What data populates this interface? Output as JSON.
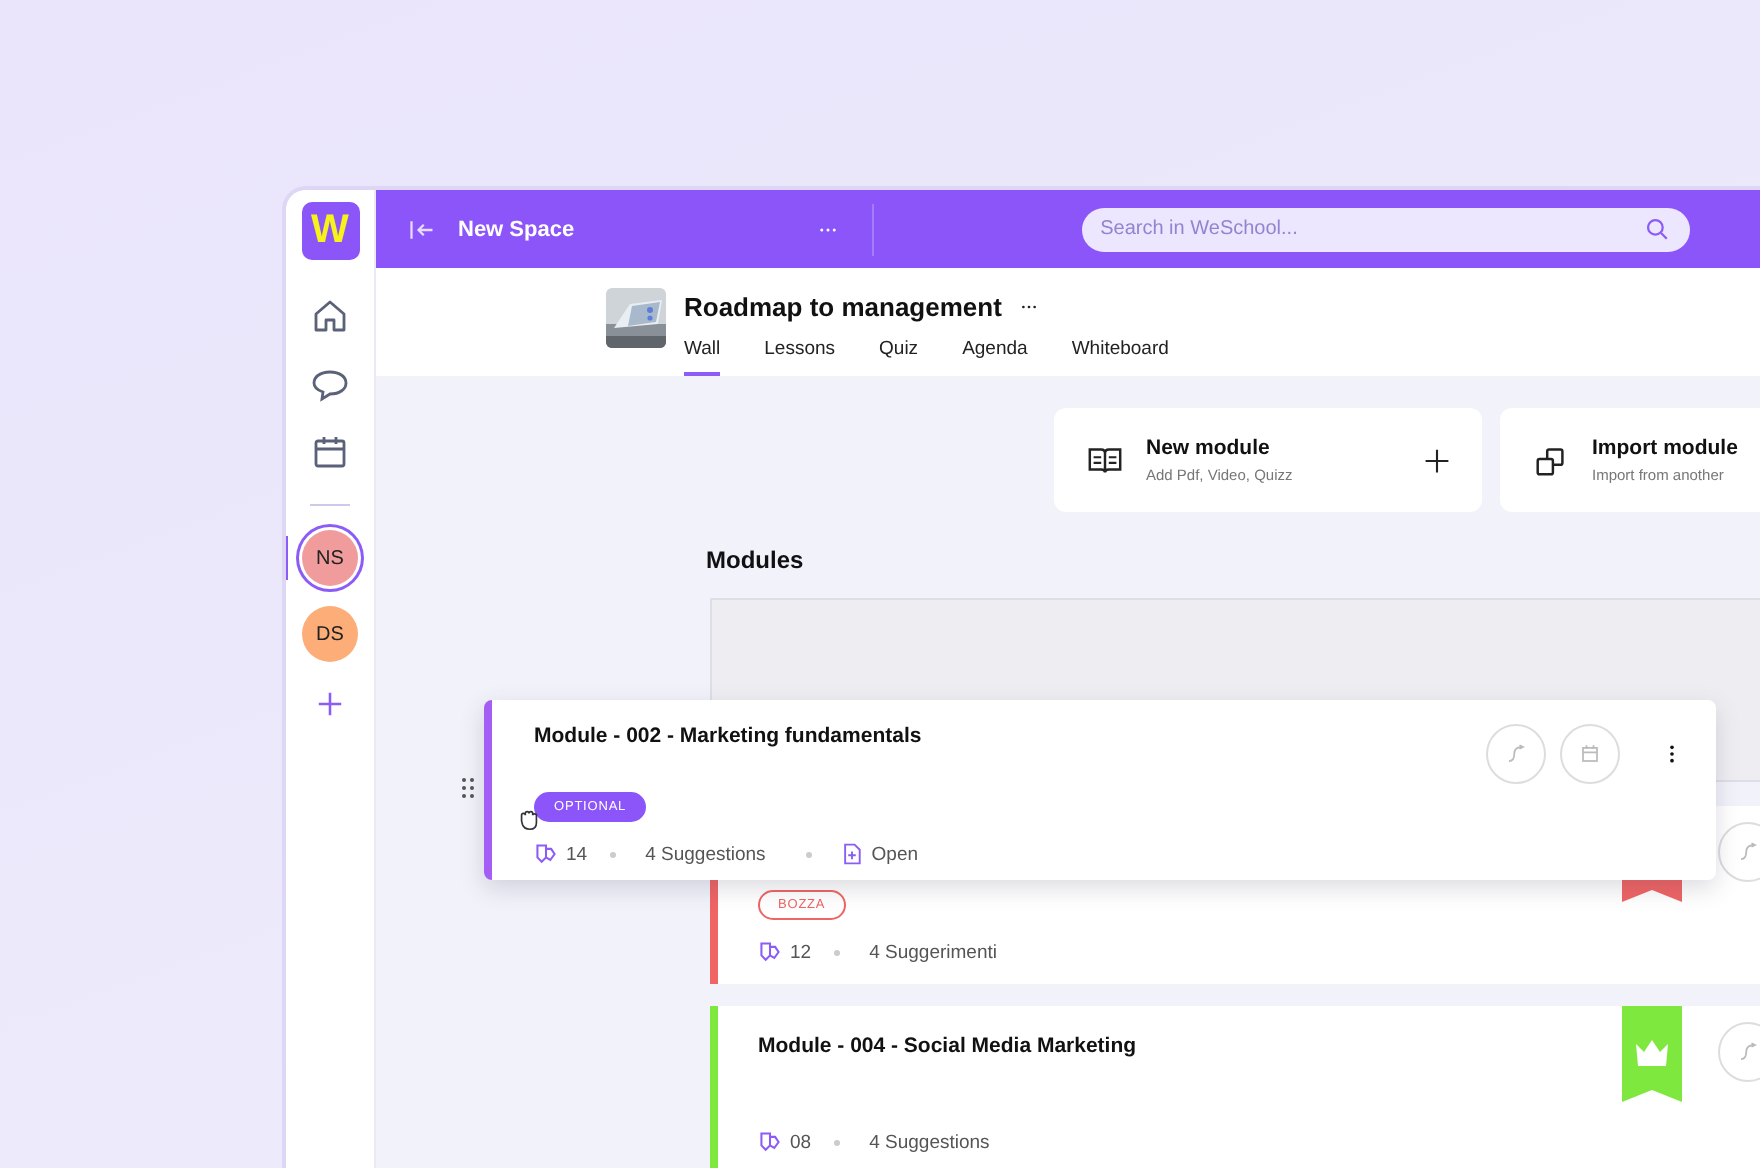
{
  "space": {
    "name": "New Space"
  },
  "search": {
    "placeholder": "Search in WeSchool..."
  },
  "sidebar": {
    "logo": "W",
    "avatars": [
      {
        "initials": "NS",
        "color": "#f19c9c",
        "selected": true
      },
      {
        "initials": "DS",
        "color": "#fdae78",
        "selected": false
      }
    ]
  },
  "course": {
    "title": "Roadmap to management",
    "tabs": [
      {
        "label": "Wall",
        "selected": true
      },
      {
        "label": "Lessons",
        "selected": false
      },
      {
        "label": "Quiz",
        "selected": false
      },
      {
        "label": "Agenda",
        "selected": false
      },
      {
        "label": "Whiteboard",
        "selected": false
      }
    ]
  },
  "actions": [
    {
      "kind": "new",
      "title": "New module",
      "subtitle": "Add Pdf, Video, Quizz"
    },
    {
      "kind": "import",
      "title": "Import module",
      "subtitle": "Import from another"
    }
  ],
  "modules_heading": "Modules",
  "dragged_module": {
    "title": "Module  - 002 - Marketing fundamentals",
    "tag": "OPTIONAL",
    "kind": "filled",
    "comments": "14",
    "suggestions": "4 Suggestions",
    "open": "Open",
    "color": "#a55ef5"
  },
  "modules": [
    {
      "tag": "BOZZA",
      "kind": "outline",
      "comments": "12",
      "suggestions": "4 Suggerimenti",
      "color": "#f06464"
    },
    {
      "title": "Module  - 004 - Social Media Marketing",
      "comments": "08",
      "suggestions": "4 Suggestions",
      "color": "#7fe83f",
      "crown": true
    }
  ]
}
